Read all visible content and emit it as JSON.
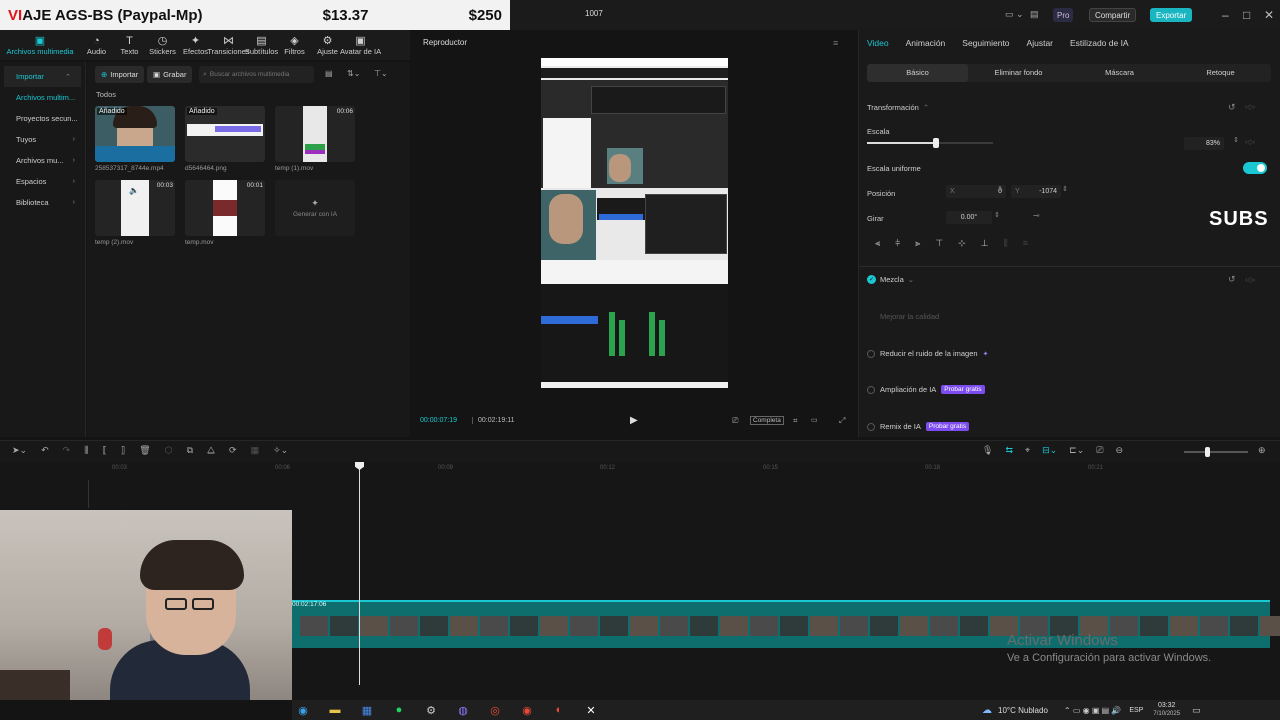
{
  "banner": {
    "title": "VIAJE AGS-BS (Paypal-Mp)",
    "title_red": "VI",
    "amount1": "$13.37",
    "amount2": "$250"
  },
  "window": {
    "project_name": "1007",
    "pro_label": "Pro",
    "share_label": "Compartir",
    "export_label": "Exportar"
  },
  "toolbar": [
    {
      "label": "Archivos multimedia",
      "icon": "media-icon"
    },
    {
      "label": "Audio",
      "icon": "audio-icon"
    },
    {
      "label": "Texto",
      "icon": "text-icon"
    },
    {
      "label": "Stickers",
      "icon": "sticker-icon"
    },
    {
      "label": "Efectos",
      "icon": "effects-icon"
    },
    {
      "label": "Transiciones",
      "icon": "transitions-icon"
    },
    {
      "label": "Subtítulos",
      "icon": "subtitles-icon"
    },
    {
      "label": "Filtros",
      "icon": "filters-icon"
    },
    {
      "label": "Ajuste",
      "icon": "adjust-icon"
    },
    {
      "label": "Avatar de IA",
      "icon": "avatar-icon"
    }
  ],
  "leftnav": [
    {
      "label": "Importar"
    },
    {
      "label": "Archivos multim..."
    },
    {
      "label": "Proyectos secun..."
    },
    {
      "label": "Tuyos"
    },
    {
      "label": "Archivos mu..."
    },
    {
      "label": "Espacios"
    },
    {
      "label": "Biblioteca"
    }
  ],
  "media": {
    "import_label": "Importar",
    "record_label": "Grabar",
    "search_placeholder": "Buscar archivos multimedia",
    "filter_all": "Todos",
    "items": [
      {
        "name": "258537317_8744e.mp4",
        "tag": "Añadido",
        "dur": ""
      },
      {
        "name": "d5646464.png",
        "tag": "Añadido",
        "dur": ""
      },
      {
        "name": "temp (1).mov",
        "tag": "",
        "dur": "00:06"
      },
      {
        "name": "temp (2).mov",
        "tag": "",
        "dur": "00:03"
      },
      {
        "name": "temp.mov",
        "tag": "",
        "dur": "00:01"
      },
      {
        "name": "Generar con IA",
        "tag": "",
        "dur": ""
      }
    ]
  },
  "player": {
    "title": "Reproductor",
    "current_time": "00:00:07:19",
    "total_time": "00:02:19:11",
    "quality_label": "Completa"
  },
  "inspector": {
    "tabs": [
      "Video",
      "Animación",
      "Seguimiento",
      "Ajustar",
      "Estilizado de IA"
    ],
    "subtabs": [
      "Básico",
      "Eliminar fondo",
      "Máscara",
      "Retoque"
    ],
    "transform_label": "Transformación",
    "scale_label": "Escala",
    "scale_value": "83%",
    "scale_fraction": 0.83,
    "uniform_label": "Escala uniforme",
    "position_label": "Posición",
    "pos_x_label": "X",
    "pos_x": "0",
    "pos_y_label": "Y",
    "pos_y": "-1074",
    "rotate_label": "Girar",
    "rotate_value": "0.00°",
    "blend_label": "Mezcla",
    "enhance_label": "Mejorar la calidad",
    "denoise_label": "Reducir el ruido de la imagen",
    "ai_expand_label": "Ampliación de IA",
    "remix_label": "Remix de IA",
    "free_badge": "Probar gratis",
    "overlay_text": "SUBS"
  },
  "timeline": {
    "ticks": [
      "00:03",
      "00:06",
      "00:09",
      "00:12",
      "00:15",
      "00:18",
      "00:21"
    ],
    "clip_time": "00:02:17:06"
  },
  "watermark": {
    "line1": "Activar Windows",
    "line2": "Ve a Configuración para activar Windows."
  },
  "taskbar": {
    "weather": "10°C  Nublado",
    "lang": "ESP",
    "time": "03:32",
    "date": "7/10/2025"
  }
}
